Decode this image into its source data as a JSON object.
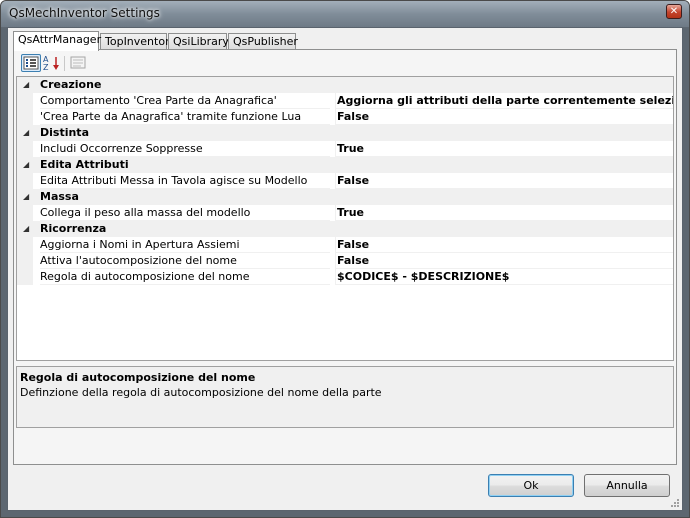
{
  "window": {
    "title": "QsMechInventor Settings"
  },
  "tabs": [
    {
      "label": "QsAttrManager",
      "active": true
    },
    {
      "label": "TopInventor",
      "active": false
    },
    {
      "label": "QsiLibrary",
      "active": false
    },
    {
      "label": "QsPublisher",
      "active": false
    }
  ],
  "toolbar": {
    "categorized_icon": "categorized-view-icon",
    "alphabetical_icon": "sort-az-icon",
    "property_pages_icon": "property-pages-icon"
  },
  "grid": {
    "categories": [
      {
        "name": "Creazione",
        "properties": [
          {
            "name": "Comportamento 'Crea Parte da Anagrafica'",
            "value": "Aggiorna gli attributi della parte correntemente selezionata"
          },
          {
            "name": "'Crea Parte da Anagrafica' tramite funzione Lua",
            "value": "False"
          }
        ]
      },
      {
        "name": "Distinta",
        "properties": [
          {
            "name": "Includi Occorrenze Soppresse",
            "value": "True"
          }
        ]
      },
      {
        "name": "Edita Attributi",
        "properties": [
          {
            "name": "Edita Attributi Messa in Tavola agisce su Modello",
            "value": "False"
          }
        ]
      },
      {
        "name": "Massa",
        "properties": [
          {
            "name": "Collega il peso alla massa del modello",
            "value": "True"
          }
        ]
      },
      {
        "name": "Ricorrenza",
        "properties": [
          {
            "name": "Aggiorna i Nomi in Apertura Assiemi",
            "value": "False"
          },
          {
            "name": "Attiva l'autocomposizione del nome",
            "value": "False"
          },
          {
            "name": "Regola di autocomposizione del nome",
            "value": "$CODICE$ - $DESCRIZIONE$"
          }
        ]
      }
    ]
  },
  "help": {
    "title": "Regola di autocomposizione del nome",
    "description": "Definzione della regola di autocomposizione del nome della parte"
  },
  "buttons": {
    "ok": "Ok",
    "cancel": "Annulla"
  }
}
